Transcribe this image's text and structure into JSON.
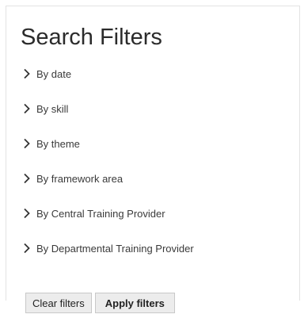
{
  "panel": {
    "title": "Search Filters"
  },
  "filters": [
    {
      "label": "By date",
      "icon": "chevron-right-icon"
    },
    {
      "label": "By skill",
      "icon": "chevron-right-icon"
    },
    {
      "label": "By theme",
      "icon": "chevron-right-icon"
    },
    {
      "label": "By framework area",
      "icon": "chevron-right-icon"
    },
    {
      "label": "By Central Training Provider",
      "icon": "chevron-right-icon"
    },
    {
      "label": "By Departmental Training Provider",
      "icon": "chevron-right-icon"
    }
  ],
  "actions": {
    "clear_label": "Clear filters",
    "apply_label": "Apply filters"
  },
  "colors": {
    "text": "#333333",
    "chevron": "#333333",
    "button_bg": "#ececec",
    "button_border": "#c8c8c8"
  }
}
